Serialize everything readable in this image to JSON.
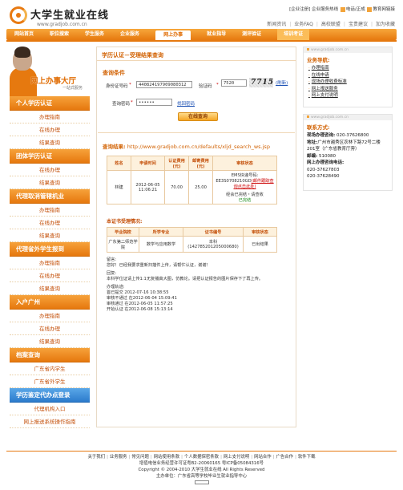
{
  "brand": {
    "title": "大学生就业在线",
    "url": "www.gradjob.com.cn"
  },
  "top_links": {
    "enterprise_register": "[企业注册]",
    "enterprise_service": "企业服务热线",
    "email_label": "电话/正成",
    "education_label": "教育网链接",
    "nav": [
      "新闻资讯",
      "业务FAQ",
      "高校联盟",
      "宝贵建议",
      "加为收藏"
    ]
  },
  "nav": {
    "items": [
      "网站首页",
      "职位搜索",
      "学生服务",
      "企业服务",
      "网上办事",
      "就业指导",
      "测评验证",
      "培训考证"
    ],
    "active_index": 4,
    "highlight_index": 7
  },
  "banner": {
    "main": "网上办事大厅",
    "sub": "一站式服务"
  },
  "sidebar": {
    "sections": [
      {
        "title": "个人学历认证",
        "items": [
          "办理指南",
          "在线办理",
          "结果查询"
        ]
      },
      {
        "title": "团体学历认证",
        "items": [
          "在线办理",
          "结果查询"
        ]
      },
      {
        "title": "代理取消管辖机业",
        "items": [
          "办理指南",
          "在线办理",
          "结果查询"
        ]
      },
      {
        "title": "代理省外学生报到",
        "items": [
          "办理指南",
          "在线办理",
          "结果查询"
        ]
      },
      {
        "title": "入户广州",
        "items": [
          "办理指南",
          "在线办理",
          "结果查询"
        ]
      },
      {
        "title": "档案查询",
        "items": [
          "广东省内学生",
          "广东省外学生"
        ]
      },
      {
        "title": "学历鉴定代办点登录",
        "items": [
          "代理机构入口",
          "网上报送系统操作指南"
        ],
        "blue": true
      }
    ]
  },
  "main": {
    "page_title": "学历认证－受理结果查询",
    "query_title": "查询条件",
    "id_label": "身份证号码",
    "id_value": "440824197909080312",
    "code_label": "验证码",
    "code_value": "7520",
    "captcha_text": "7715",
    "captcha_refresh": "(刷新)",
    "pwd_label": "查询密码",
    "pwd_value": "••••••",
    "forgot_link": "找回密码",
    "query_button": "在线查询",
    "result_label": "查询结果:",
    "result_url": "http://www.gradjob.com.cn/defaults/xljd_search_ws.jsp",
    "table1": {
      "headers": [
        "姓名",
        "申请时间",
        "认证费用(元)",
        "邮寄费用(元)",
        "审核状态"
      ],
      "row": {
        "name": "林建",
        "time": "2012-06-05 11:06:21",
        "fee": "70.00",
        "post": "25.00",
        "ems": "EMS快递号码:",
        "ems_no": "EE3S0708210GD",
        "ems_link": "(邮件跟踪查询点击此处)",
        "status1": "经会已完结・请查收",
        "status2": "已完结"
      }
    },
    "sub_title": "本证书受理情况:",
    "table2": {
      "headers": [
        "毕业院校",
        "所学专业",
        "证书编号",
        "审核状态"
      ],
      "row": {
        "school": "广东第二师范学院",
        "major": "数学与应用数学",
        "cert": "本科(142785201205000680)",
        "status": "已出结果"
      }
    }
  },
  "notes": {
    "leave_msg_label": "留言:",
    "leave_msg": "您好！已经我要求重新扫描件上传，请帮忙认证，谢谢！",
    "reply_label": "回复:",
    "reply": "本科学位证请上传1:1无复播真大图，仿教论。请把认证报告的图片保存下了再上传。",
    "process_label": "办理轨迹:",
    "process": [
      "首已提交 2012-07-16 10:38:55",
      "审核不通过 在2012-06-04 15:09:41",
      "审核通过 在2012-06-05 11:57:25",
      "开始认证 在2012-06-08 15:13:14"
    ]
  },
  "right": {
    "domain": "www.gradjob.com.cn",
    "nav_title": "业务导航:",
    "nav_items": [
      "办理指南",
      "在线申请",
      "现场办理收费标准",
      "网上报送服务",
      "网上支付说明"
    ],
    "contact_title": "联系方式:",
    "phone_label": "现场办理咨询:",
    "phone": "020-37626800",
    "addr_label": "地址:",
    "addr": "广州市越秀区农林下路72号二楼201室（广东省教育厅旁）",
    "post_label": "邮编:",
    "post": "510080",
    "online_label": "网上办理咨询电话:",
    "online_phones": [
      "020-37627803",
      "020-37628490"
    ]
  },
  "footer": {
    "links": [
      "关于我们",
      "业务服务",
      "常见问题",
      "网站使用条款",
      "个人数据保密条款",
      "网上支付说明",
      "网站合作",
      "广告合作",
      "软件下载"
    ],
    "line2": "增值电信业务经营许可证粤B2-20060165 粤ICP备05084316号",
    "line3": "Copyright © 2004-2010 大学生就业在线 All Rights Reserved",
    "line4": "主办单位：广东省高等学校毕业生就业指导中心"
  },
  "colors": {
    "accent": "#e6790f",
    "accent_dark": "#d26305",
    "blue": "#2c7bcc"
  }
}
